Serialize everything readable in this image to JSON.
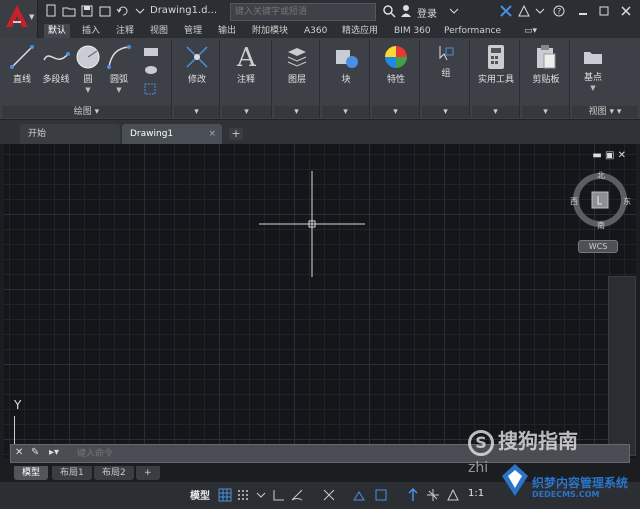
{
  "title_bar": {
    "doc_title": "Drawing1.d...",
    "search_placeholder": "键入关键字或短语",
    "login_label": "登录"
  },
  "ribbon_tabs": [
    "默认",
    "插入",
    "注释",
    "视图",
    "管理",
    "输出",
    "附加模块",
    "A360",
    "精选应用",
    "BIM 360",
    "Performance"
  ],
  "ribbon_tab_active": "默认",
  "ribbon": {
    "draw_tools": [
      "直线",
      "多段线",
      "圆",
      "圆弧"
    ],
    "draw_panel_label": "绘图",
    "modify_label": "修改",
    "annotation_label": "注释",
    "layers_label": "图层",
    "block_label": "块",
    "properties_label": "特性",
    "groups_label": "组",
    "utilities_label": "实用工具",
    "clipboard_label": "剪贴板",
    "base_label": "基点",
    "view_label": "视图"
  },
  "doc_tabs": {
    "start": "开始",
    "drawing": "Drawing1"
  },
  "viewcube": {
    "north": "北",
    "south": "南",
    "east": "东",
    "west": "西",
    "wcs": "WCS"
  },
  "ucs_y": "Y",
  "command_line": {
    "placeholder": "键入命令"
  },
  "layout_tabs": [
    "模型",
    "布局1",
    "布局2"
  ],
  "status_bar": {
    "model_label": "模型",
    "scale": "1:1"
  },
  "watermarks": {
    "sogou": "搜狗指南",
    "zhi": "zhi",
    "site_cn": "织梦内容管理系统",
    "site_url": "DEDECMS.COM"
  },
  "colors": {
    "accent_red": "#c8202a",
    "canvas_bg": "#14161a",
    "panel_bg": "#3d4046"
  }
}
